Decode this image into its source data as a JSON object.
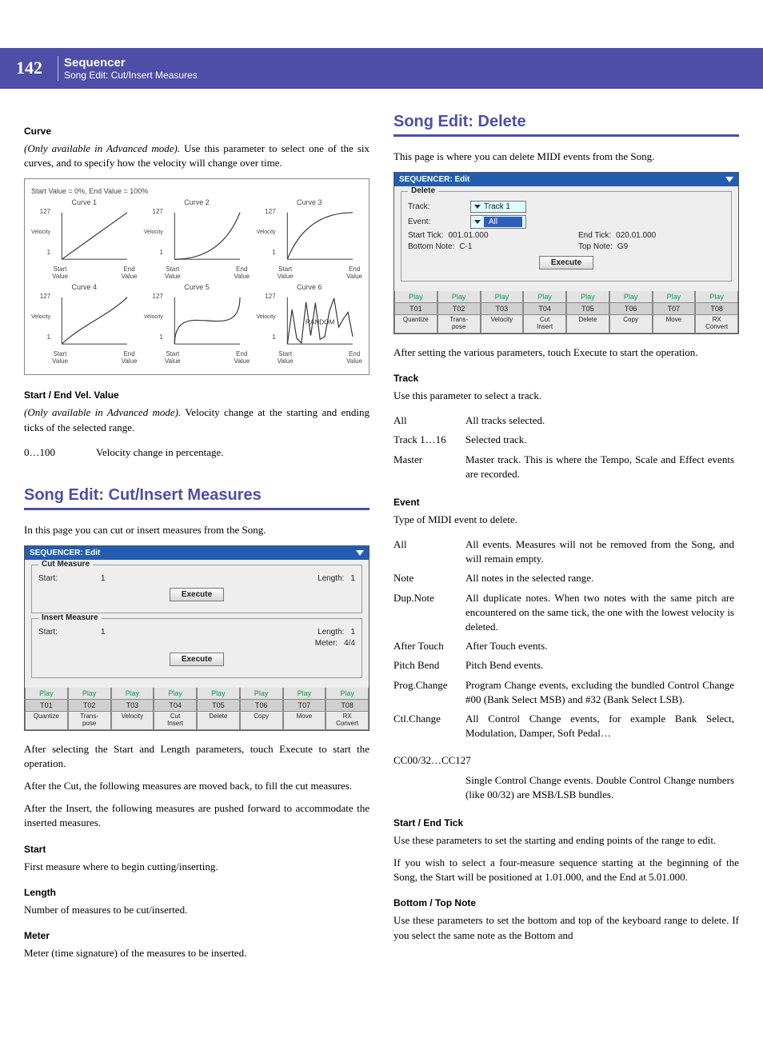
{
  "header": {
    "page_number": "142",
    "title": "Sequencer",
    "subtitle": "Song Edit: Cut/Insert Measures"
  },
  "left": {
    "curve": {
      "heading": "Curve",
      "lead_italic": "(Only available in Advanced mode).",
      "lead_rest": " Use this parameter to select one of the six curves, and to specify how the velocity will change over time.",
      "diagram": {
        "title": "Start Value = 0%, End Value = 100%",
        "curves": [
          "Curve 1",
          "Curve 2",
          "Curve 3",
          "Curve 4",
          "Curve 5",
          "Curve 6"
        ],
        "y_top": "127",
        "y_bottom": "1",
        "y_label": "Velocity",
        "x_left": "Start\nValue",
        "x_right": "End\nValue",
        "random_label": "RANDOM"
      }
    },
    "startend": {
      "heading": "Start / End Vel. Value",
      "lead_italic": "(Only available in Advanced mode).",
      "lead_rest": " Velocity change at the starting and ending ticks of the selected range.",
      "row_term": "0…100",
      "row_def": "Velocity change in percentage."
    },
    "cutinsert": {
      "heading": "Song Edit: Cut/Insert Measures",
      "intro": "In this page you can cut or insert measures from the Song.",
      "screenshot": {
        "titlebar": "SEQUENCER: Edit",
        "group1_title": "Cut Measure",
        "group2_title": "Insert Measure",
        "start_label": "Start:",
        "start_val": "1",
        "length_label": "Length:",
        "length_val": "1",
        "meter_label": "Meter:",
        "meter_val": "4/4",
        "execute": "Execute",
        "play": "Play",
        "tracks": [
          "T01",
          "T02",
          "T03",
          "T04",
          "T05",
          "T06",
          "T07",
          "T08"
        ],
        "bottom_tabs": [
          "Quantize",
          "Trans-\npose",
          "Velocity",
          "Cut\nInsert",
          "Delete",
          "Copy",
          "Move",
          "RX\nConvert"
        ]
      },
      "p1": "After selecting the Start and Length parameters, touch Execute to start the operation.",
      "p2": "After the Cut, the following measures are moved back, to fill the cut measures.",
      "p3": "After the Insert, the following measures are pushed forward to accommodate the inserted measures.",
      "start_h": "Start",
      "start_p": "First measure where to begin cutting/inserting.",
      "length_h": "Length",
      "length_p": "Number of measures to be cut/inserted.",
      "meter_h": "Meter",
      "meter_p": "Meter (time signature) of the measures to be inserted."
    }
  },
  "right": {
    "delete": {
      "heading": "Song Edit: Delete",
      "intro": "This page is where you can delete MIDI events from the Song.",
      "screenshot": {
        "titlebar": "SEQUENCER: Edit",
        "group_title": "Delete",
        "track_label": "Track:",
        "track_val": "Track 1",
        "event_label": "Event:",
        "event_val": "All",
        "start_tick_label": "Start Tick:",
        "start_tick_val": "001.01.000",
        "end_tick_label": "End Tick:",
        "end_tick_val": "020.01.000",
        "bottom_note_label": "Bottom Note:",
        "bottom_note_val": "C-1",
        "top_note_label": "Top Note:",
        "top_note_val": "G9",
        "execute": "Execute",
        "play": "Play",
        "tracks": [
          "T01",
          "T02",
          "T03",
          "T04",
          "T05",
          "T06",
          "T07",
          "T08"
        ],
        "bottom_tabs": [
          "Quantize",
          "Trans-\npose",
          "Velocity",
          "Cut\nInsert",
          "Delete",
          "Copy",
          "Move",
          "RX\nConvert"
        ]
      },
      "p_after": "After setting the various parameters, touch Execute to start the operation.",
      "track_h": "Track",
      "track_p": "Use this parameter to select a track.",
      "track_rows": [
        {
          "term": "All",
          "def": "All tracks selected."
        },
        {
          "term": "Track 1…16",
          "def": "Selected track."
        },
        {
          "term": "Master",
          "def": "Master track. This is where the Tempo, Scale and Effect events are recorded."
        }
      ],
      "event_h": "Event",
      "event_p": "Type of MIDI event to delete.",
      "event_rows": [
        {
          "term": "All",
          "def": "All events. Measures will not be removed from the Song, and will remain empty."
        },
        {
          "term": "Note",
          "def": "All notes in the selected range."
        },
        {
          "term": "Dup.Note",
          "def": "All duplicate notes. When two notes with the same pitch are encountered on the same tick, the one with the lowest velocity is deleted."
        },
        {
          "term": "After Touch",
          "def": "After Touch events."
        },
        {
          "term": "Pitch Bend",
          "def": "Pitch Bend events."
        },
        {
          "term": "Prog.Change",
          "def": "Program Change events, excluding the bundled Control Change #00 (Bank Select MSB) and #32 (Bank Select LSB)."
        },
        {
          "term": "Ctl.Change",
          "def": "All Control Change events, for example Bank Select, Modulation, Damper, Soft Pedal…"
        }
      ],
      "cc_term": "CC00/32…CC127",
      "cc_def": "Single Control Change events. Double Control Change numbers (like 00/32) are MSB/LSB bundles.",
      "se_h": "Start / End Tick",
      "se_p1": "Use these parameters to set the starting and ending points of the range to edit.",
      "se_p2": "If you wish to select a four-measure sequence starting at the beginning of the Song, the Start will be positioned at 1.01.000, and the End at 5.01.000.",
      "bt_h": "Bottom / Top Note",
      "bt_p": "Use these parameters to set the bottom and top of the keyboard range to delete. If you select the same note as the Bottom and"
    }
  }
}
